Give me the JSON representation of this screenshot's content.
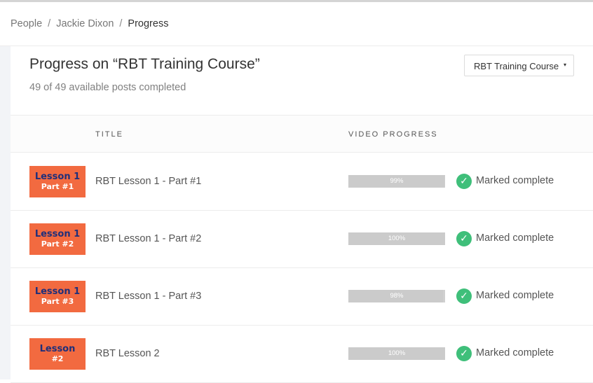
{
  "breadcrumb": {
    "items": [
      "People",
      "Jackie Dixon",
      "Progress"
    ],
    "separator": "/"
  },
  "page": {
    "title": "Progress on “RBT Training Course”",
    "subtitle": "49 of 49 available posts completed"
  },
  "course_select": {
    "selected": "RBT Training Course",
    "caret": "▾"
  },
  "table": {
    "columns": {
      "title": "TITLE",
      "progress": "VIDEO PROGRESS"
    },
    "rows": [
      {
        "thumb_line1": "Lesson 1",
        "thumb_line2": "Part #1",
        "title": "RBT Lesson 1 - Part #1",
        "progress_label": "99%",
        "progress": 0.99,
        "status": "Marked complete"
      },
      {
        "thumb_line1": "Lesson 1",
        "thumb_line2": "Part #2",
        "title": "RBT Lesson 1 - Part #2",
        "progress_label": "100%",
        "progress": 1.0,
        "status": "Marked complete"
      },
      {
        "thumb_line1": "Lesson 1",
        "thumb_line2": "Part #3",
        "title": "RBT Lesson 1 - Part #3",
        "progress_label": "98%",
        "progress": 0.98,
        "status": "Marked complete"
      },
      {
        "thumb_line1": "Lesson",
        "thumb_line2": "#2",
        "title": "RBT Lesson 2",
        "progress_label": "100%",
        "progress": 1.0,
        "status": "Marked complete"
      }
    ]
  },
  "icons": {
    "check": "check-circle-icon"
  },
  "colors": {
    "thumb_bg": "#f26a40",
    "thumb_text": "#1f2f7a",
    "check": "#3fbf7a",
    "progress_bar": "#cfcfcf"
  }
}
